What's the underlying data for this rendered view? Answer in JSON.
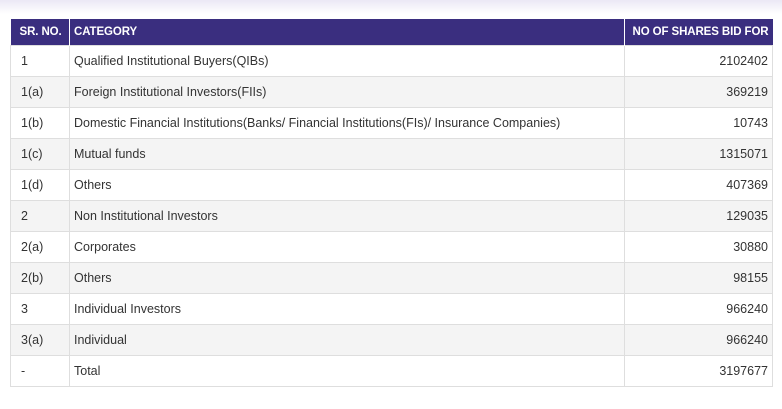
{
  "table": {
    "headers": [
      "SR. NO.",
      "CATEGORY",
      "NO OF SHARES BID FOR"
    ],
    "rows": [
      {
        "sr": "1",
        "category": "Qualified Institutional Buyers(QIBs)",
        "shares": "2102402"
      },
      {
        "sr": "1(a)",
        "category": "Foreign Institutional Investors(FIIs)",
        "shares": "369219"
      },
      {
        "sr": "1(b)",
        "category": "Domestic Financial Institutions(Banks/ Financial Institutions(FIs)/ Insurance Companies)",
        "shares": "10743"
      },
      {
        "sr": "1(c)",
        "category": "Mutual funds",
        "shares": "1315071"
      },
      {
        "sr": "1(d)",
        "category": "Others",
        "shares": "407369"
      },
      {
        "sr": "2",
        "category": "Non Institutional Investors",
        "shares": "129035"
      },
      {
        "sr": "2(a)",
        "category": "Corporates",
        "shares": "30880"
      },
      {
        "sr": "2(b)",
        "category": "Others",
        "shares": "98155"
      },
      {
        "sr": "3",
        "category": "Individual Investors",
        "shares": "966240"
      },
      {
        "sr": "3(a)",
        "category": "Individual",
        "shares": "966240"
      },
      {
        "sr": "-",
        "category": "Total",
        "shares": "3197677"
      }
    ]
  },
  "colors": {
    "header_bg": "#3a2e7f",
    "header_text": "#ffffff",
    "row_alt_bg": "#f4f4f4",
    "border": "#dedede"
  }
}
